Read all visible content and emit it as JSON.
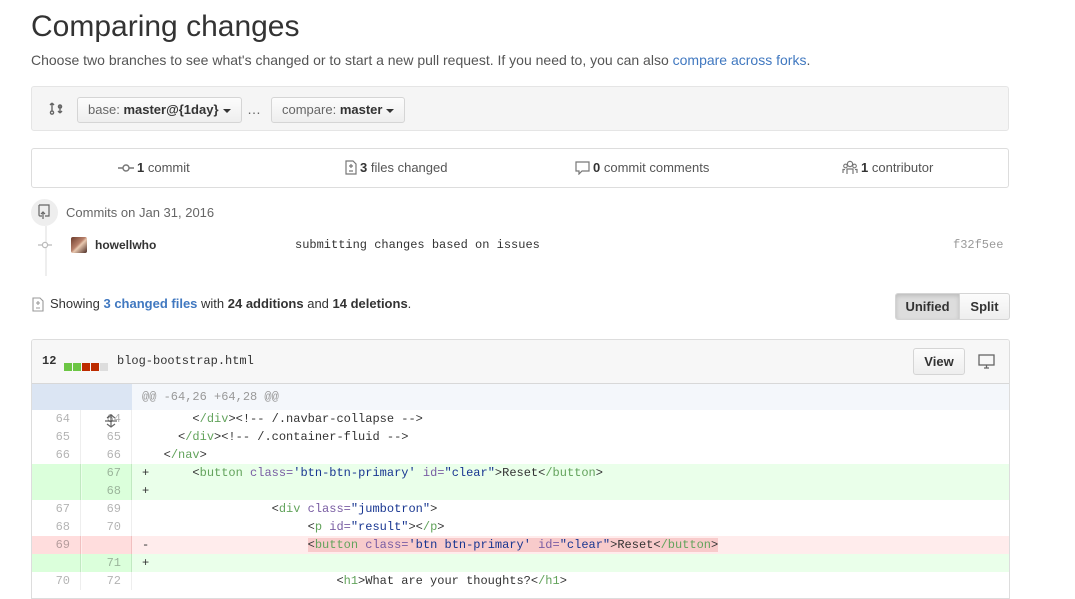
{
  "page": {
    "title": "Comparing changes",
    "subtitle": "Choose two branches to see what's changed or to start a new pull request. If you need to, you can also ",
    "subtitle_link": "compare across forks",
    "subtitle_end": "."
  },
  "range": {
    "base_label": "base:",
    "base_value": "master@{1day}",
    "separator": "…",
    "compare_label": "compare:",
    "compare_value": "master"
  },
  "stats": {
    "commits_count": "1",
    "commits_label": "commit",
    "files_count": "3",
    "files_label": "files changed",
    "comments_count": "0",
    "comments_label": "commit comments",
    "contributors_count": "1",
    "contributors_label": "contributor"
  },
  "commits": {
    "heading": "Commits on Jan 31, 2016",
    "items": [
      {
        "author": "howellwho",
        "message": "submitting changes based on issues",
        "sha": "f32f5ee"
      }
    ]
  },
  "summary": {
    "prefix": "Showing ",
    "files_link": "3 changed files",
    "mid1": " with ",
    "additions": "24 additions",
    "mid2": " and ",
    "deletions": "14 deletions",
    "end": "."
  },
  "view_toggle": {
    "unified": "Unified",
    "split": "Split",
    "selected": "Unified"
  },
  "file": {
    "change_count": "12",
    "diffstat_colors": [
      "#6cc644",
      "#6cc644",
      "#bd2c00",
      "#bd2c00",
      "#ddd"
    ],
    "name": "blog-bootstrap.html",
    "view_label": "View",
    "hunk_header": "@@ -64,26 +64,28 @@",
    "lines": [
      {
        "old": "64",
        "new": "64",
        "type": "ctx",
        "sign": " ",
        "text": "    </div><!-- /.navbar-collapse -->"
      },
      {
        "old": "65",
        "new": "65",
        "type": "ctx",
        "sign": " ",
        "text": "  </div><!-- /.container-fluid -->"
      },
      {
        "old": "66",
        "new": "66",
        "type": "ctx",
        "sign": " ",
        "text": "</nav>"
      },
      {
        "old": "",
        "new": "67",
        "type": "add",
        "sign": "+",
        "text": "    <button class='btn-btn-primary' id=\"clear\">Reset</button>"
      },
      {
        "old": "",
        "new": "68",
        "type": "add",
        "sign": "+",
        "text": ""
      },
      {
        "old": "67",
        "new": "69",
        "type": "ctx",
        "sign": " ",
        "text": "               <div class=\"jumbotron\">"
      },
      {
        "old": "68",
        "new": "70",
        "type": "ctx",
        "sign": " ",
        "text": "                    <p id=\"result\"></p>"
      },
      {
        "old": "69",
        "new": "",
        "type": "del",
        "sign": "-",
        "text": "                    <button class='btn btn-primary' id=\"clear\">Reset</button>"
      },
      {
        "old": "",
        "new": "71",
        "type": "add",
        "sign": "+",
        "text": ""
      },
      {
        "old": "70",
        "new": "72",
        "type": "ctx",
        "sign": " ",
        "text": "                        <h1>What are your thoughts?</h1>"
      }
    ]
  }
}
